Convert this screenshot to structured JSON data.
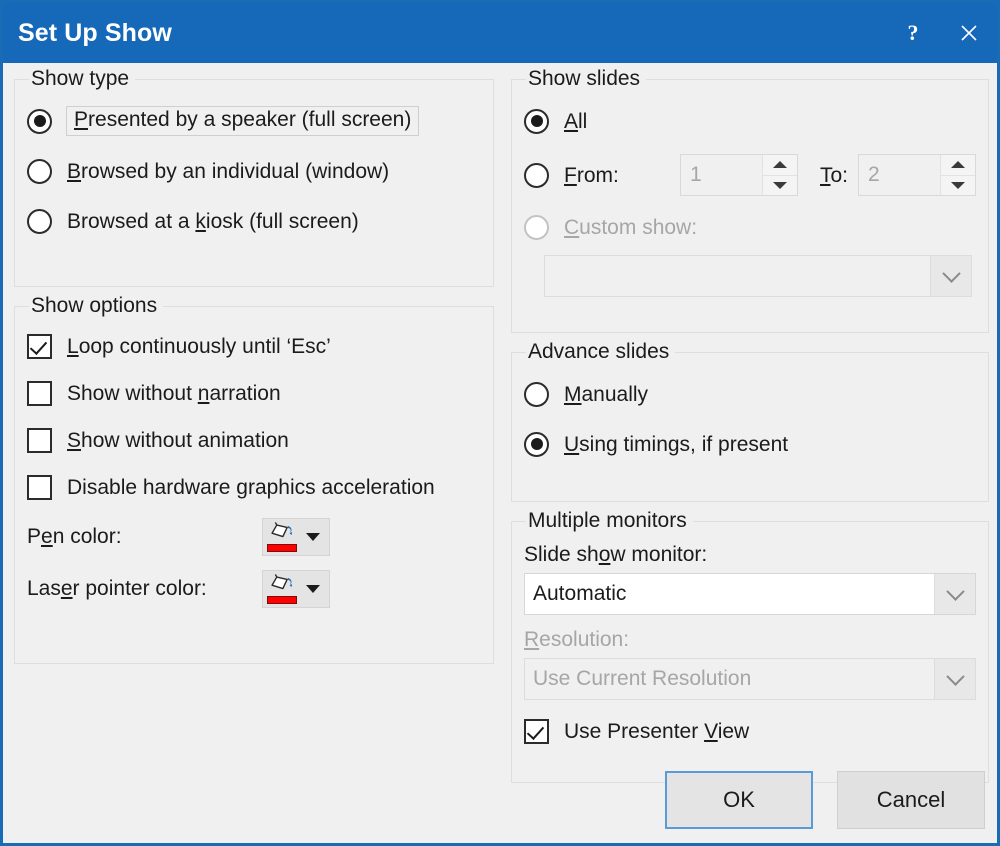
{
  "window": {
    "title": "Set Up Show",
    "help_glyph": "?",
    "close_glyph": "✕",
    "accent_color": "#1668b8",
    "body_color": "#f0f0f0"
  },
  "show_type": {
    "title": "Show type",
    "options": [
      {
        "label": "Presented by a speaker (full screen)",
        "accesskey": "P",
        "selected": true,
        "focused": true
      },
      {
        "label": "Browsed by an individual (window)",
        "accesskey": "B",
        "selected": false,
        "focused": false
      },
      {
        "label": "Browsed at a kiosk (full screen)",
        "accesskey": "k",
        "selected": false,
        "focused": false
      }
    ]
  },
  "show_options": {
    "title": "Show options",
    "checkboxes": [
      {
        "label": "Loop continuously until ‘Esc’",
        "accesskey": "L",
        "checked": true
      },
      {
        "label": "Show without narration",
        "accesskey": "n",
        "checked": false
      },
      {
        "label": "Show without animation",
        "accesskey": "S",
        "checked": false
      },
      {
        "label": "Disable hardware graphics acceleration",
        "accesskey": "g",
        "checked": false
      }
    ],
    "pen_color": {
      "label": "Pen color:",
      "accesskey": "e",
      "swatch_color": "#ff0000",
      "icon": "paint-bucket-icon"
    },
    "laser_pointer_color": {
      "label": "Laser pointer color:",
      "accesskey": "e",
      "swatch_color": "#ff0000",
      "icon": "paint-bucket-icon"
    }
  },
  "show_slides": {
    "title": "Show slides",
    "all": {
      "label": "All",
      "accesskey": "A",
      "selected": true
    },
    "from": {
      "label": "From:",
      "accesskey": "F",
      "selected": false,
      "value": "1",
      "disabled": true
    },
    "to": {
      "label": "To:",
      "accesskey": "T",
      "value": "2",
      "disabled": true
    },
    "custom_show": {
      "label": "Custom show:",
      "accesskey": "C",
      "selected": false,
      "disabled": true,
      "value": "",
      "placeholder": ""
    }
  },
  "advance_slides": {
    "title": "Advance slides",
    "options": [
      {
        "label": "Manually",
        "accesskey": "M",
        "selected": false
      },
      {
        "label": "Using timings, if present",
        "accesskey": "U",
        "selected": true
      }
    ]
  },
  "multiple_monitors": {
    "title": "Multiple monitors",
    "slide_show_monitor": {
      "label": "Slide show monitor:",
      "accesskey": "o",
      "value": "Automatic",
      "disabled": false
    },
    "resolution": {
      "label": "Resolution:",
      "accesskey": "R",
      "value": "Use Current Resolution",
      "disabled": true
    },
    "use_presenter_view": {
      "label": "Use Presenter View",
      "accesskey": "V",
      "checked": true
    }
  },
  "footer": {
    "ok_label": "OK",
    "cancel_label": "Cancel"
  }
}
